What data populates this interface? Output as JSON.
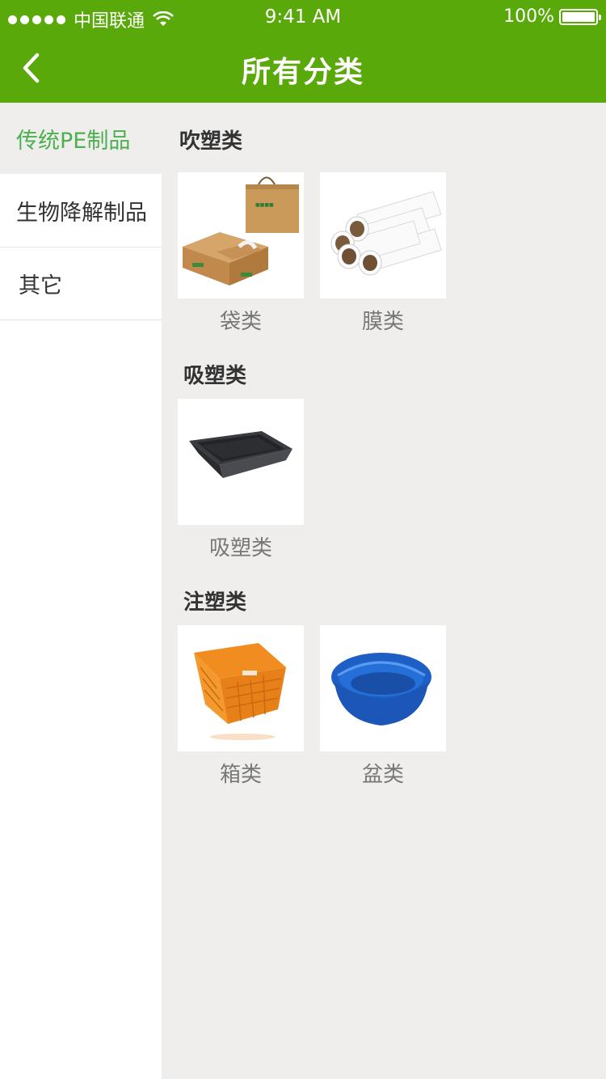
{
  "status_bar": {
    "carrier": "中国联通",
    "time": "9:41 AM",
    "battery": "100%"
  },
  "nav": {
    "title": "所有分类",
    "back_icon": "chevron-left-icon"
  },
  "colors": {
    "brand_green": "#5aa90a",
    "active_green": "#4caf50"
  },
  "sidebar": {
    "items": [
      {
        "label": "传统PE制品",
        "active": true
      },
      {
        "label": "生物降解制品",
        "active": false
      },
      {
        "label": "其它",
        "active": false
      }
    ]
  },
  "sections": [
    {
      "title": "吹塑类",
      "items": [
        {
          "label": "袋类",
          "image": "kraft-bags-and-boxes"
        },
        {
          "label": "膜类",
          "image": "film-rolls"
        }
      ]
    },
    {
      "title": "吸塑类",
      "items": [
        {
          "label": "吸塑类",
          "image": "black-plastic-tray"
        }
      ]
    },
    {
      "title": "注塑类",
      "items": [
        {
          "label": "箱类",
          "image": "orange-crate"
        },
        {
          "label": "盆类",
          "image": "blue-basin"
        }
      ]
    }
  ]
}
